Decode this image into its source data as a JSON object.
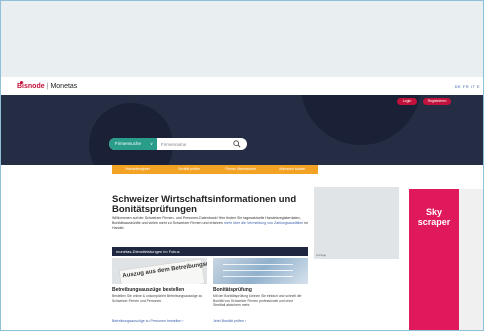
{
  "header": {
    "logo_brand": "Bisnode",
    "logo_separator": "|",
    "logo_product": "Monetas",
    "languages": "DE FR IT E"
  },
  "hero": {
    "login_label": "Login",
    "register_label": "Registrieren",
    "search": {
      "type_label": "Firmensuche",
      "placeholder": "Firmenname"
    }
  },
  "nav": {
    "items": [
      "Handelsregister",
      "Bonität prüfen",
      "Firmen überwachen",
      "Adressen kaufen"
    ]
  },
  "main": {
    "title": "Schweizer Wirtschaftsinformationen und Bonitätsprüfungen",
    "intro": "Willkommen auf der Schweizer Firmen- und Personen-Datenbank! Hier finden Sie tagesaktuelle Handelsregisterdaten, Bonitätsauskünfte und vieles mehr zu Schweizer Firmen und erfahren",
    "intro_link": "mehr über die Vermeidung von Zahlungsausfällen",
    "intro_end": "im Handel.",
    "focus_title": "monetas-Dienstleistungen im Fokus",
    "cards": [
      {
        "image_text": "Auszug aus dem Betreibungsregister",
        "title": "Betreibungsauszüge bestellen",
        "text": "Bestellen Sie online & unkompliziert Betreibungsauszüge zu Schweizer Firmen und Personen.",
        "link": "Betreibungsauszüge zu Personen bestellen"
      },
      {
        "title": "Bonitätsprüfung",
        "text": "Mit der Bonitätsprüfung können Sie einfach und schnell die Bonität von Schweizer Firmen professionell und ohne Streitfall absichern mehr.",
        "link": "Jetzt Bonität prüfen"
      }
    ]
  },
  "ads": {
    "box_label": "Anzeige",
    "skyscraper_line1": "Sky",
    "skyscraper_line2": "scraper"
  },
  "colors": {
    "brand_red": "#c2113b",
    "hero_navy": "#242d44",
    "search_teal": "#2a9d8a",
    "nav_orange": "#f2a324",
    "skyscraper_pink": "#e0195d"
  }
}
